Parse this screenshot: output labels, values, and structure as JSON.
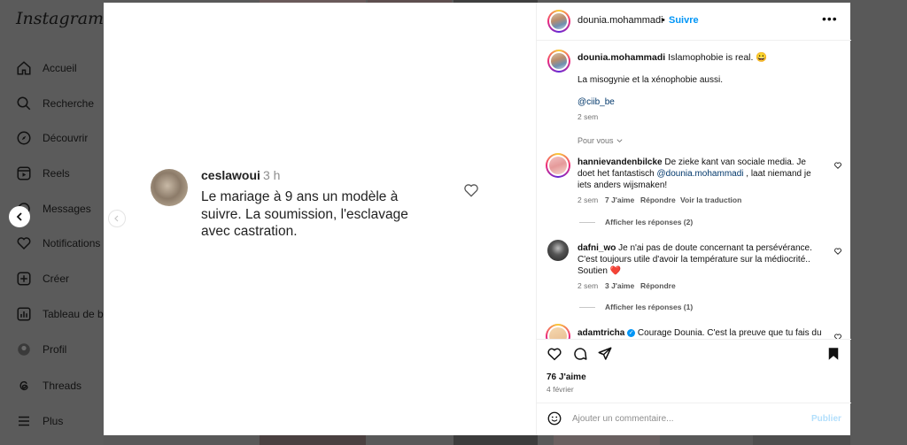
{
  "app": {
    "logo": "Instagram"
  },
  "sidebar": {
    "items": [
      {
        "label": "Accueil",
        "icon": "home-icon"
      },
      {
        "label": "Recherche",
        "icon": "search-icon"
      },
      {
        "label": "Découvrir",
        "icon": "explore-icon"
      },
      {
        "label": "Reels",
        "icon": "reels-icon"
      },
      {
        "label": "Messages",
        "icon": "messages-icon"
      },
      {
        "label": "Notifications",
        "icon": "heart-icon"
      },
      {
        "label": "Créer",
        "icon": "plus-square-icon"
      },
      {
        "label": "Tableau de bo",
        "icon": "dashboard-icon"
      },
      {
        "label": "Profil",
        "icon": "avatar-icon"
      },
      {
        "label": "Threads",
        "icon": "threads-icon"
      },
      {
        "label": "Plus",
        "icon": "menu-icon"
      }
    ]
  },
  "media": {
    "comment_user": "ceslawoui",
    "comment_time": "3 h",
    "comment_text": "Le mariage à 9 ans un modèle à suivre. La soumission,  l'esclavage avec castration."
  },
  "post": {
    "author": "dounia.mohammadi",
    "separator": "•",
    "follow_label": "Suivre",
    "more_label": "•••",
    "caption_author": "dounia.mohammadi",
    "caption_line1": "Islamophobie is real. 😀",
    "caption_line2": "La misogynie et la xénophobie aussi.",
    "caption_mention": "@ciib_be",
    "caption_time": "2 sem",
    "see_translation": "Pour vous",
    "comments": [
      {
        "user": "hannievandenbilcke",
        "text_before": "De zieke kant van sociale media. Je doet het fantastisch ",
        "mention": "@dounia.mohammadi",
        "text_after": " , laat niemand je iets anders wijsmaken!",
        "time": "2 sem",
        "likes": "7 J'aime",
        "reply": "Répondre",
        "translate": "Voir la traduction",
        "replies": "Afficher les réponses (2)"
      },
      {
        "user": "dafni_wo",
        "text": "Je n'ai pas de doute concernant ta persévérance. C'est toujours utile d'avoir la température sur la médiocrité.. Soutien ❤️",
        "time": "2 sem",
        "likes": "3 J'aime",
        "reply": "Répondre",
        "replies": "Afficher les réponses (1)"
      },
      {
        "user": "adamtricha",
        "text": "Courage Dounia. C'est la preuve que tu fais du"
      }
    ],
    "likes": "76 J'aime",
    "date": "4 février",
    "add_comment_placeholder": "Ajouter un commentaire...",
    "publish_label": "Publier"
  }
}
